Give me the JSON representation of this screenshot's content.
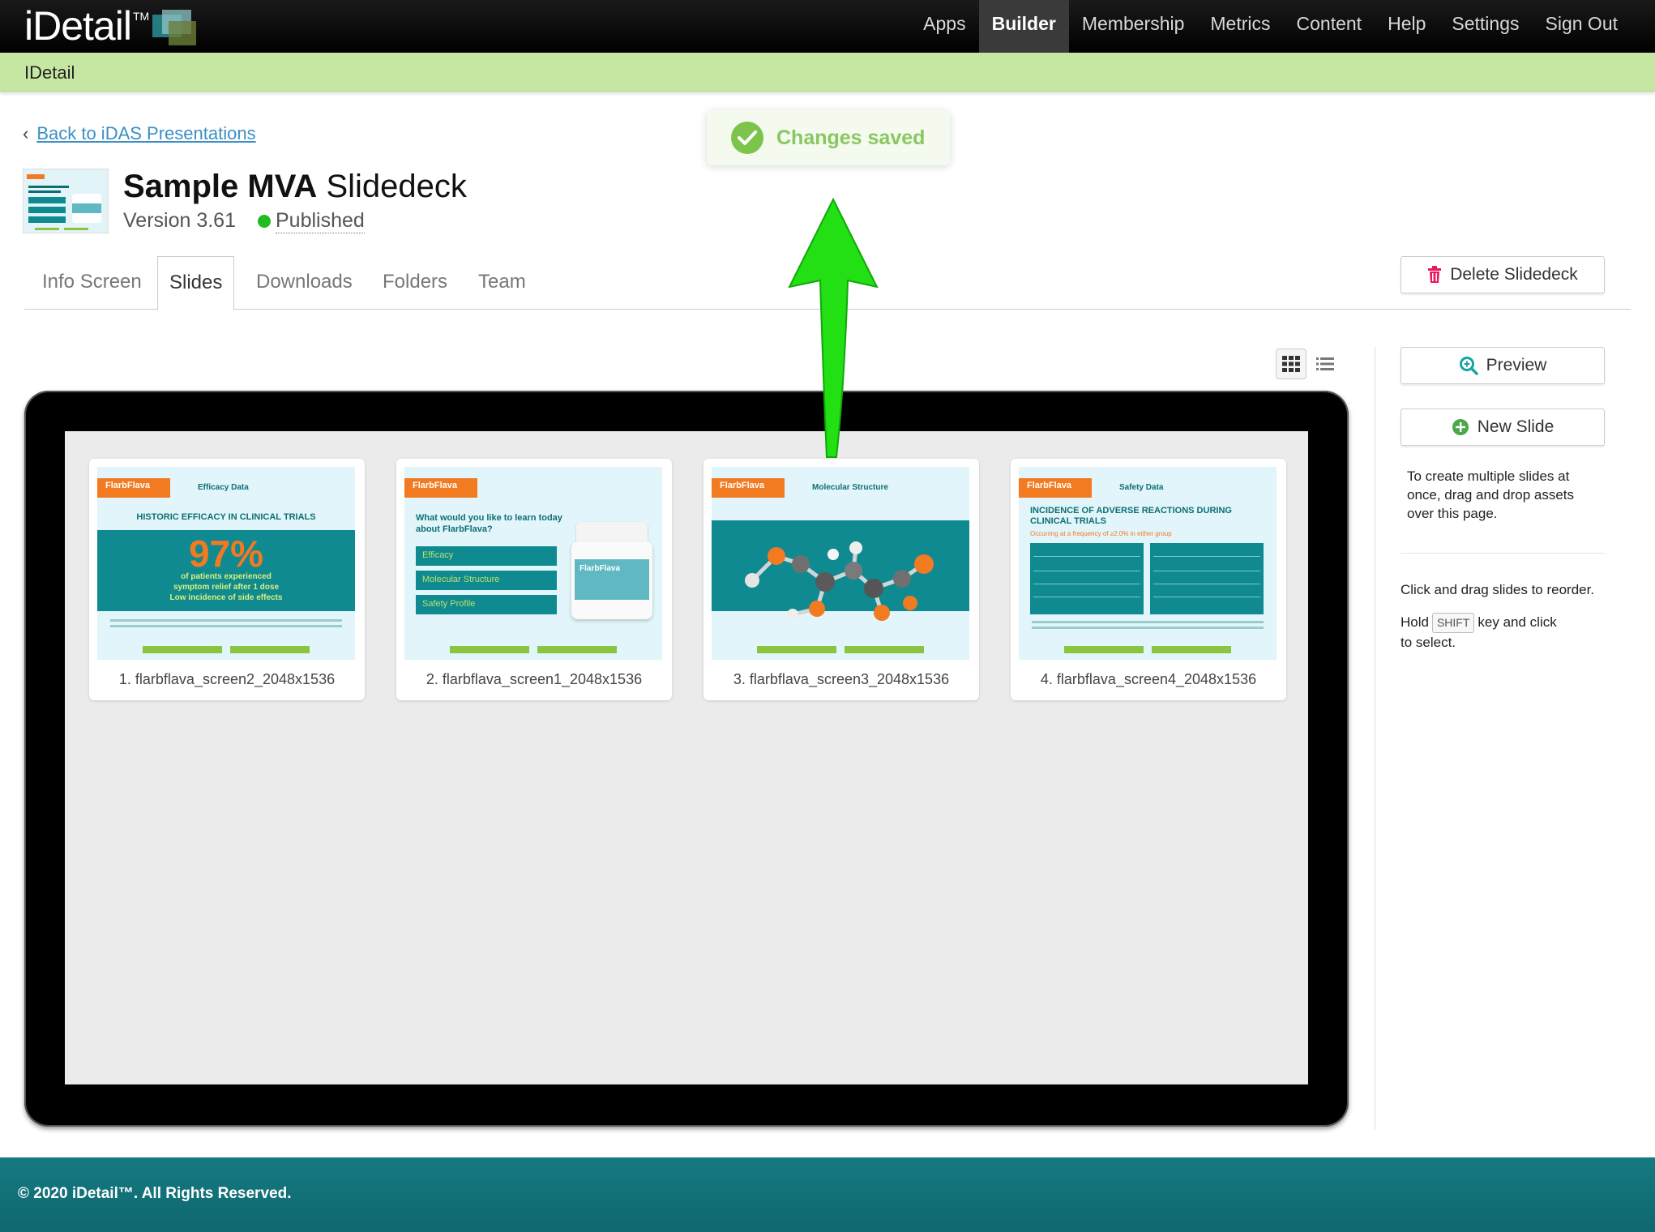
{
  "logo": {
    "text": "iDetail",
    "tm": "TM"
  },
  "nav": [
    {
      "label": "Apps"
    },
    {
      "label": "Builder"
    },
    {
      "label": "Membership"
    },
    {
      "label": "Metrics"
    },
    {
      "label": "Content"
    },
    {
      "label": "Help"
    },
    {
      "label": "Settings"
    },
    {
      "label": "Sign Out"
    }
  ],
  "nav_active": "Builder",
  "subbar": {
    "title": "IDetail"
  },
  "back_link": {
    "label": "Back to iDAS Presentations"
  },
  "toast": {
    "message": "Changes saved"
  },
  "deck": {
    "title_bold": "Sample MVA",
    "title_light": " Slidedeck",
    "version": "Version 3.61",
    "status": "Published"
  },
  "tabs": [
    {
      "label": "Info Screen"
    },
    {
      "label": "Slides"
    },
    {
      "label": "Downloads"
    },
    {
      "label": "Folders"
    },
    {
      "label": "Team"
    }
  ],
  "active_tab": "Slides",
  "delete_button": {
    "label": "Delete Slidedeck"
  },
  "slides": [
    {
      "caption": "1. flarbflava_screen2_2048x1536",
      "brand": "FlarbFlava",
      "section": "Efficacy Data",
      "heading": "HISTORIC EFFICACY IN CLINICAL TRIALS",
      "big": "97%",
      "sub1": "of patients experienced",
      "sub2": "symptom relief after 1 dose",
      "sub3": "Low incidence of side effects"
    },
    {
      "caption": "2. flarbflava_screen1_2048x1536",
      "brand": "FlarbFlava",
      "question": "What would you like to learn today about FlarbFlava?",
      "menu": [
        "Efficacy",
        "Molecular Structure",
        "Safety Profile"
      ],
      "bottle_label": "FlarbFlava"
    },
    {
      "caption": "3. flarbflava_screen3_2048x1536",
      "brand": "FlarbFlava",
      "section": "Molecular Structure"
    },
    {
      "caption": "4. flarbflava_screen4_2048x1536",
      "brand": "FlarbFlava",
      "section": "Safety Data",
      "heading": "INCIDENCE OF ADVERSE REACTIONS DURING CLINICAL TRIALS",
      "sub": "Occurring at a frequency of ≥2.0% in either group"
    }
  ],
  "sidebar": {
    "preview_label": "Preview",
    "new_slide_label": "New Slide",
    "drop_note": "To create multiple slides at once, drag and drop assets over this page.",
    "reorder_note": "Click and drag slides to reorder.",
    "hold_text": "Hold",
    "shift_key": "SHIFT",
    "select_text": "key and click",
    "select_text2": "to select."
  },
  "footer": {
    "text": "© 2020 iDetail™.  All Rights Reserved."
  },
  "colors": {
    "accent_green": "#c6e7a2",
    "teal": "#0f8a90",
    "orange": "#f27a21",
    "link": "#3b8fc4"
  }
}
